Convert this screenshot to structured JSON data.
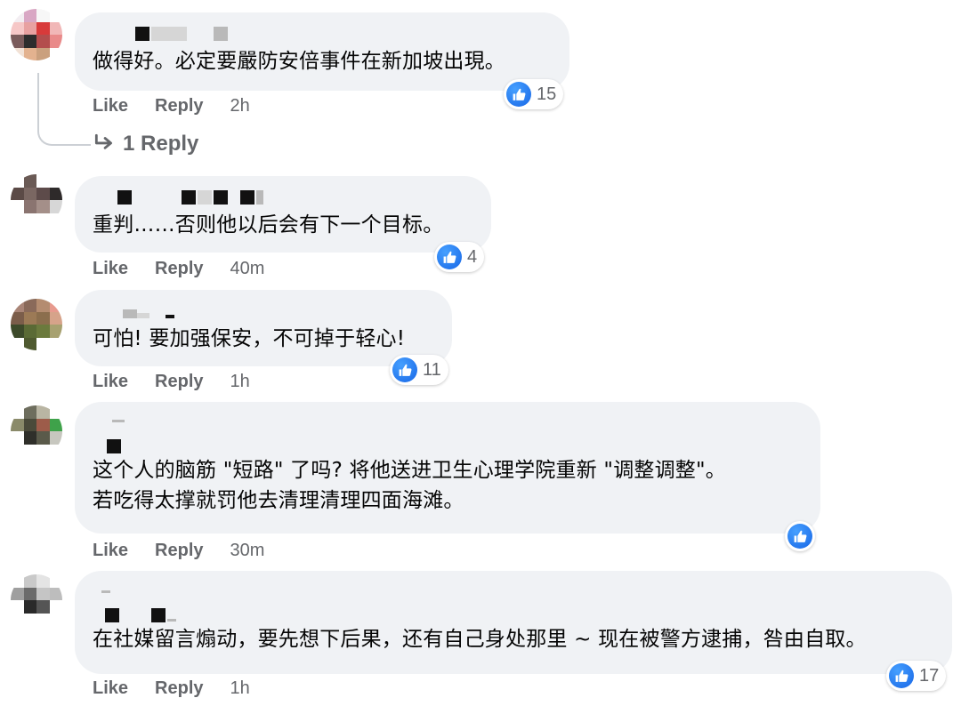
{
  "like_label": "Like",
  "reply_label": "Reply",
  "colors": {
    "accent": "#1877f2",
    "bubble": "#f0f2f5",
    "meta": "#65676b"
  },
  "comments": [
    {
      "text_lines": [
        "做得好。必定要嚴防安倍事件在新加坡出現。"
      ],
      "reactions": "15",
      "time": "2h",
      "replies_label": "1 Reply"
    },
    {
      "text_lines": [
        "重判……否则他以后会有下一个目标。"
      ],
      "reactions": "4",
      "time": "40m"
    },
    {
      "text_lines": [
        "可怕! 要加强保安，不可掉于轻心!"
      ],
      "reactions": "11",
      "time": "1h"
    },
    {
      "text_lines": [
        "这个人的脑筋 \"短路\" 了吗?  将他送进卫生心理学院重新 \"调整调整\"。",
        "若吃得太撑就罚他去清理清理四面海滩。"
      ],
      "reactions": "",
      "time": "30m"
    },
    {
      "text_lines": [
        "在社媒留言煽动，要先想下后果，还有自己身处那里 ~ 现在被警方逮捕，咎由自取。"
      ],
      "reactions": "17",
      "time": "1h"
    }
  ]
}
